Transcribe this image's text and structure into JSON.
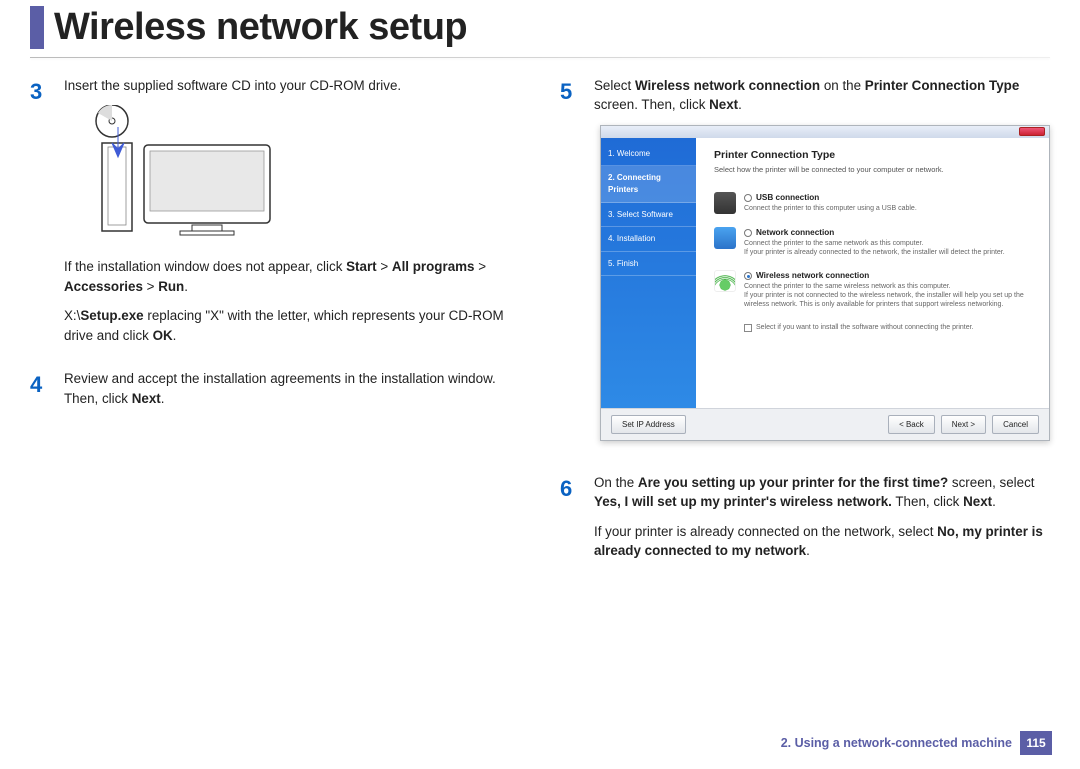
{
  "header": {
    "title": "Wireless network setup"
  },
  "left": {
    "step3_num": "3",
    "step3_text": "Insert the supplied software CD into your CD-ROM drive.",
    "step3_p2_a": "If the installation window does not appear, click ",
    "step3_p2_b": "Start",
    "step3_p2_c": " > ",
    "step3_p2_d": "All programs",
    "step3_p2_e": " > ",
    "step3_p2_f": "Accessories",
    "step3_p2_g": " > ",
    "step3_p2_h": "Run",
    "step3_p2_i": ".",
    "step3_p3_a": " X:\\",
    "step3_p3_b": "Setup.exe",
    "step3_p3_c": " replacing \"X\" with the letter, which represents your CD-ROM drive and click ",
    "step3_p3_d": "OK",
    "step3_p3_e": ".",
    "step4_num": "4",
    "step4_a": "Review and accept the installation agreements in the installation window. Then, click ",
    "step4_b": "Next",
    "step4_c": "."
  },
  "right": {
    "step5_num": "5",
    "step5_a": "Select ",
    "step5_b": "Wireless network connection",
    "step5_c": " on the ",
    "step5_d": "Printer Connection Type",
    "step5_e": " screen. Then, click ",
    "step5_f": "Next",
    "step5_g": ".",
    "step6_num": "6",
    "step6_a": "On the ",
    "step6_b": "Are you setting up your printer for the first time?",
    "step6_c": " screen, select ",
    "step6_d": "Yes, I will set up my printer's wireless network.",
    "step6_e": " Then, click ",
    "step6_f": "Next",
    "step6_g": ".",
    "step6_p2_a": "If your printer is already connected on the network, select ",
    "step6_p2_b": "No, my printer is already connected to my network",
    "step6_p2_c": "."
  },
  "dialog": {
    "side": {
      "welcome": "1. Welcome",
      "connecting": "2. Connecting Printers",
      "select": "3. Select Software",
      "install": "4. Installation",
      "finish": "5. Finish"
    },
    "heading": "Printer Connection Type",
    "sub": "Select how the printer will be connected to your computer or network.",
    "opt_usb_title": "USB connection",
    "opt_usb_desc": "Connect the printer to this computer using a USB cable.",
    "opt_net_title": "Network connection",
    "opt_net_desc": "Connect the printer to the same network as this computer.\nIf your printer is already connected to the network, the installer will detect the printer.",
    "opt_wifi_title": "Wireless network connection",
    "opt_wifi_desc": "Connect the printer to the same wireless network as this computer.\nIf your printer is not connected to the wireless network, the installer will help you set up the wireless network. This is only available for printers that support wireless networking.",
    "checkbox": "Select if you want to install the software without connecting the printer.",
    "btn_ip": "Set IP Address",
    "btn_back": "< Back",
    "btn_next": "Next >",
    "btn_cancel": "Cancel"
  },
  "footer": {
    "chapter": "2.  Using a network-connected machine",
    "page": "115"
  }
}
